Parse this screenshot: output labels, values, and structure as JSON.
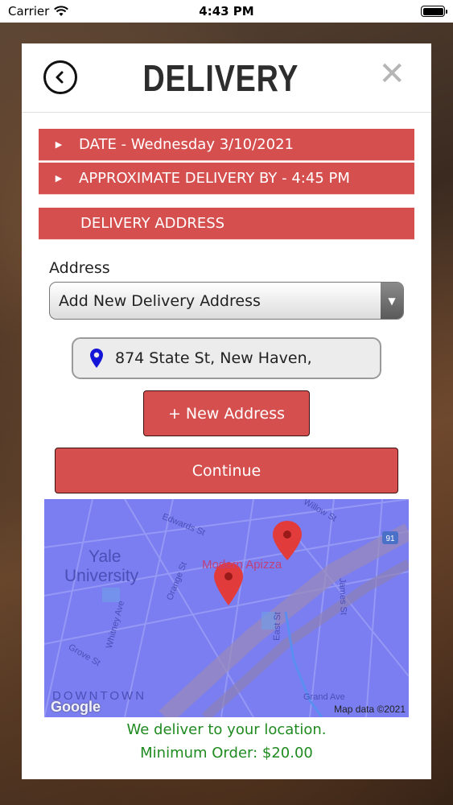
{
  "status_bar": {
    "carrier": "Carrier",
    "time": "4:43 PM"
  },
  "modal": {
    "title": "DELIVERY",
    "close_symbol": "✕",
    "date_row": "DATE - Wednesday 3/10/2021",
    "approx_row": "APPROXIMATE DELIVERY BY - 4:45 PM",
    "section_header": "DELIVERY ADDRESS",
    "address_label": "Address",
    "address_select_value": "Add New Delivery Address",
    "address_value": "874 State St, New Haven,",
    "new_address_button": "+ New Address",
    "continue_button": "Continue",
    "deliver_message": "We deliver to your location.",
    "minimum_order": "Minimum Order: $20.00"
  },
  "map": {
    "university_line1": "Yale",
    "university_line2": "University",
    "place_label": "Modern Apizza",
    "streets": [
      "Edwards St",
      "Willow St",
      "Orange St",
      "Whitney Ave",
      "Grove St",
      "James St",
      "East St",
      "Grand Ave"
    ],
    "district": "DOWNTOWN",
    "highway": "91",
    "attribution": "Map data ©2021",
    "logo": "Google"
  },
  "colors": {
    "accent_red": "#d64f4f",
    "success_green": "#1f8a1f",
    "map_tint": "#7a7ef0"
  }
}
